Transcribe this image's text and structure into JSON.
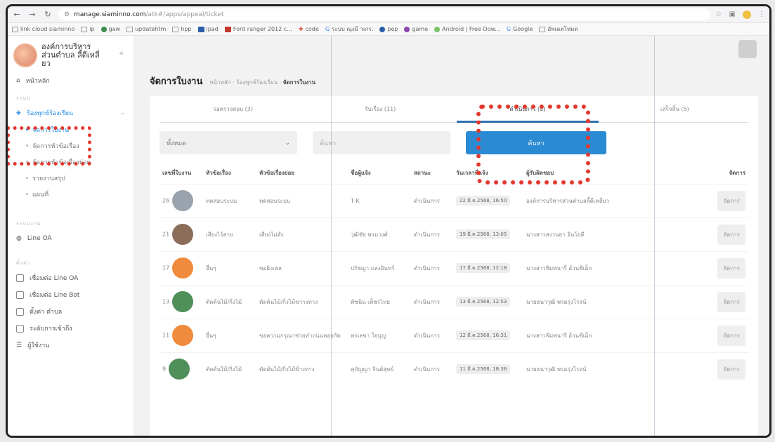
{
  "browser": {
    "url_host": "manage.siaminno.com",
    "url_path": "/atk#/apps/appeal/ticket",
    "bookmarks": [
      "link cloud siaminno",
      "ip",
      "gaw",
      "updatehtm",
      "hpp",
      "ipad",
      "Ford ranger 2012 c...",
      "code",
      "ระบบ ณุงมี วเกร.",
      "pep",
      "game",
      "Android | Free Dow...",
      "Google",
      "อัพเดตโหมด"
    ]
  },
  "sidebar": {
    "brand": "องค์การบริหารส่วนตำบล ลี้ดีเหลี่ยว",
    "home": "หน้าหลัก",
    "section1": "ระบบ",
    "group": "ร้องทุกข์ร้องเรียน",
    "subs": [
      {
        "label": "จัดการใบงาน",
        "active": true
      },
      {
        "label": "จัดการหัวข้อเรื่อง",
        "active": false
      },
      {
        "label": "จัดการหัวข้อเรื่องย่อย",
        "active": false
      },
      {
        "label": "รายงานสรุป",
        "active": false
      },
      {
        "label": "แผนที่",
        "active": false
      }
    ],
    "section2": "ระบบงาน",
    "line_oa": "Line OA",
    "section3": "ตั้งค่า",
    "settings": [
      "เชื่อมต่อ Line OA",
      "เชื่อมต่อ Line Bot",
      "ตั้งค่า ตำบล",
      "ระดับการเข้าถึง",
      "ผู้ใช้งาน"
    ]
  },
  "page": {
    "title": "จัดการใบงาน",
    "breadcrumb": [
      "หน้าหลัก",
      "ร้องทุกข์ร้องเรียน",
      "จัดการใบงาน"
    ]
  },
  "tabs": [
    {
      "label": "รอตรวจสอบ (3)",
      "active": false
    },
    {
      "label": "รับเรื่อง (11)",
      "active": false
    },
    {
      "label": "ดำเนินการ (8)",
      "active": true
    },
    {
      "label": "เสร็จสิ้น (5)",
      "active": false
    }
  ],
  "filters": {
    "select_value": "ทั้งหมด",
    "search_placeholder": "ค้นหา",
    "button_label": "ค้นหา"
  },
  "table": {
    "headers": [
      "เลขที่ใบงาน",
      "หัวข้อเรื่อง",
      "หัวข้อเรื่องย่อย",
      "ชื่อผู้แจ้ง",
      "สถานะ",
      "วันเวลาที่แจ้ง",
      "ผู้รับผิดชอบ",
      "จัดการ"
    ],
    "rows": [
      {
        "id": "26",
        "thumb": "#9aa3ad",
        "topic": "ทดสอบระบบ",
        "subtopic": "ทดสอบระบบ",
        "reporter": "T K",
        "status": "ดำเนินการ",
        "date": "22 มี.ค.2568, 16:50",
        "owner": "องค์การบริหารส่วนตำบลลี้ดีเหลี่ยว",
        "action": "จัดการ"
      },
      {
        "id": "21",
        "thumb": "#8b6e5a",
        "topic": "เสียงไร้สาย",
        "subtopic": "เสียงไม่ดัง",
        "reporter": "วุฒิชัย พรมวงศ์",
        "status": "ดำเนินการ",
        "date": "19 มี.ค.2568, 13:05",
        "owner": "นางสาวสงวนยา อินโยดี",
        "action": "จัดการ"
      },
      {
        "id": "17",
        "thumb": "#f08a3c",
        "topic": "อื่นๆ",
        "subtopic": "ขออิงเพล",
        "reporter": "ปรัชญา แสงอินทร์",
        "status": "ดำเนินการ",
        "date": "17 มี.ค.2568, 12:18",
        "owner": "นางสาวพิมพนารี อ้วนชีเม็ก",
        "action": "จัดการ"
      },
      {
        "id": "13",
        "thumb": "#4f8f5a",
        "topic": "ตัดต้นไม้/กิ่งไม้",
        "subtopic": "ตัดต้นไม้/กิ่งไม้ขวางทาง",
        "reporter": "พัชนิน เพ็ชรไทย",
        "status": "ดำเนินการ",
        "date": "13 มี.ค.2568, 12:53",
        "owner": "นายธนาวุฒิ พรมรุ่งโรจน์",
        "action": "จัดการ"
      },
      {
        "id": "11",
        "thumb": "#f08a3c",
        "topic": "อื่นๆ",
        "subtopic": "ขอความกรุณาช่วยทำถนนหอยกัด",
        "reporter": "พรเลขา ใจบุญ",
        "status": "ดำเนินการ",
        "date": "12 มี.ค.2568, 16:31",
        "owner": "นางสาวพิมพนารี อ้วนชีเม็ก",
        "action": "จัดการ"
      },
      {
        "id": "9",
        "thumb": "#4f8f5a",
        "topic": "ตัดต้นไม้/กิ่งไม้",
        "subtopic": "ตัดต้นไม้/กิ่งไม้ข้างทาง",
        "reporter": "ศุภัญญา จินต์สุทย์",
        "status": "ดำเนินการ",
        "date": "11 มี.ค.2568, 18:36",
        "owner": "นายธนาวุฒิ พรมรุ่งโรจน์",
        "action": "จัดการ"
      }
    ]
  },
  "colors": {
    "accent": "#2a8bd2",
    "highlight": "#e3372c",
    "tab_underline": "#2f6fb0"
  }
}
